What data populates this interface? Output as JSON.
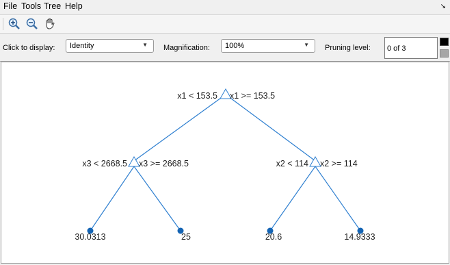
{
  "menu": {
    "file": "File",
    "tools": "Tools",
    "tree": "Tree",
    "help": "Help"
  },
  "controls": {
    "display_label": "Click to display:",
    "display_value": "Identity",
    "magnification_label": "Magnification:",
    "magnification_value": "100%",
    "pruning_label": "Pruning level:",
    "pruning_value": "0 of 3"
  },
  "colors": {
    "edge": "#2e7fd0",
    "leaf": "#1464b4",
    "swatch_dark": "#000000",
    "swatch_light": "#a6a6a6"
  },
  "tree": {
    "root": {
      "left_rule": "x1 < 153.5",
      "right_rule": "x1 >= 153.5"
    },
    "left_node": {
      "left_rule": "x3 < 2668.5",
      "right_rule": "x3 >= 2668.5"
    },
    "right_node": {
      "left_rule": "x2 < 114",
      "right_rule": "x2 >= 114"
    },
    "leaves": [
      "30.0313",
      "25",
      "20.6",
      "14.9333"
    ]
  }
}
